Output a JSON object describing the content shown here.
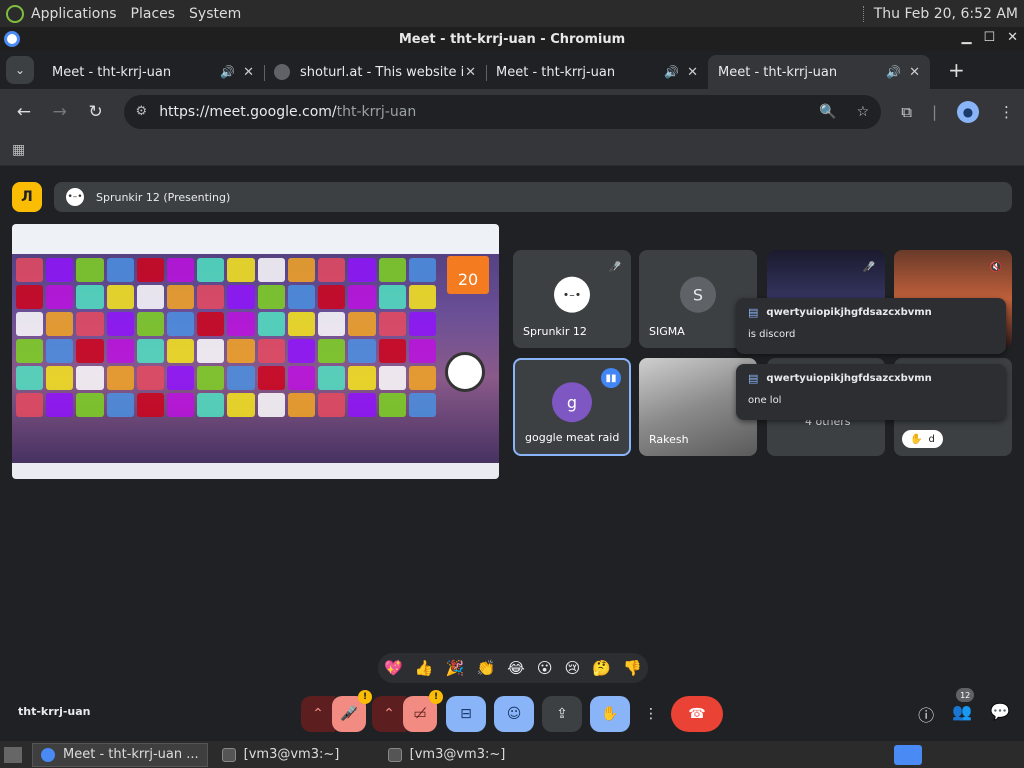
{
  "system_panel": {
    "menus": [
      "Applications",
      "Places",
      "System"
    ],
    "clock": "Thu Feb 20,  6:52 AM"
  },
  "window": {
    "title": "Meet - tht-krrj-uan - Chromium"
  },
  "tabs": [
    {
      "label": "Meet - tht-krrj-uan",
      "favicon": "meet-icon",
      "audio": true,
      "active": false
    },
    {
      "label": "shoturl.at - This website is",
      "favicon": "web-icon",
      "audio": false,
      "active": false
    },
    {
      "label": "Meet - tht-krrj-uan",
      "favicon": "meet-icon",
      "audio": true,
      "active": false
    },
    {
      "label": "Meet - tht-krrj-uan",
      "favicon": "meet-icon",
      "audio": true,
      "active": true
    }
  ],
  "address_bar": {
    "url_host": "https://meet.google.com/",
    "url_path": "tht-krrj-uan"
  },
  "meet": {
    "presenting_label": "Sprunkir 12 (Presenting)",
    "presenter_badge": "Л",
    "participants": [
      {
        "name": "Sprunkir 12",
        "avatar": "•–•",
        "muted": true
      },
      {
        "name": "SIGMA",
        "avatar": "S",
        "muted": false
      },
      {
        "name": "",
        "avatar": "",
        "muted": true
      },
      {
        "name": "",
        "avatar": "",
        "muted": true
      },
      {
        "name": "goggle meat raid",
        "avatar": "g",
        "speaking": true
      },
      {
        "name": "Rakesh",
        "avatar": ""
      },
      {
        "name": "4 others",
        "avatar": ""
      },
      {
        "name": "d",
        "avatar": ""
      }
    ],
    "chat_popups": [
      {
        "sender": "qwertyuiopikjhgfdsazcxbvmn",
        "message": "is discord"
      },
      {
        "sender": "qwertyuiopikjhgfdsazcxbvmn",
        "message": "one lol"
      }
    ],
    "reactions": [
      "💖",
      "👍",
      "🎉",
      "👏",
      "😂",
      "😮",
      "😢",
      "🤔",
      "👎"
    ],
    "meeting_code": "tht-krrj-uan",
    "people_count": "12",
    "shared_screen": {
      "calendar_day": "20"
    }
  },
  "taskbar": [
    {
      "label": "Meet - tht-krrj-uan ...",
      "icon": "chrome",
      "active": true
    },
    {
      "label": "[vm3@vm3:~]",
      "icon": "terminal",
      "active": false
    },
    {
      "label": "[vm3@vm3:~]",
      "icon": "terminal",
      "active": false
    }
  ],
  "colors": {
    "accent": "#8ab4f8",
    "hangup": "#ea4335",
    "presenter_badge": "#fbbc04"
  }
}
